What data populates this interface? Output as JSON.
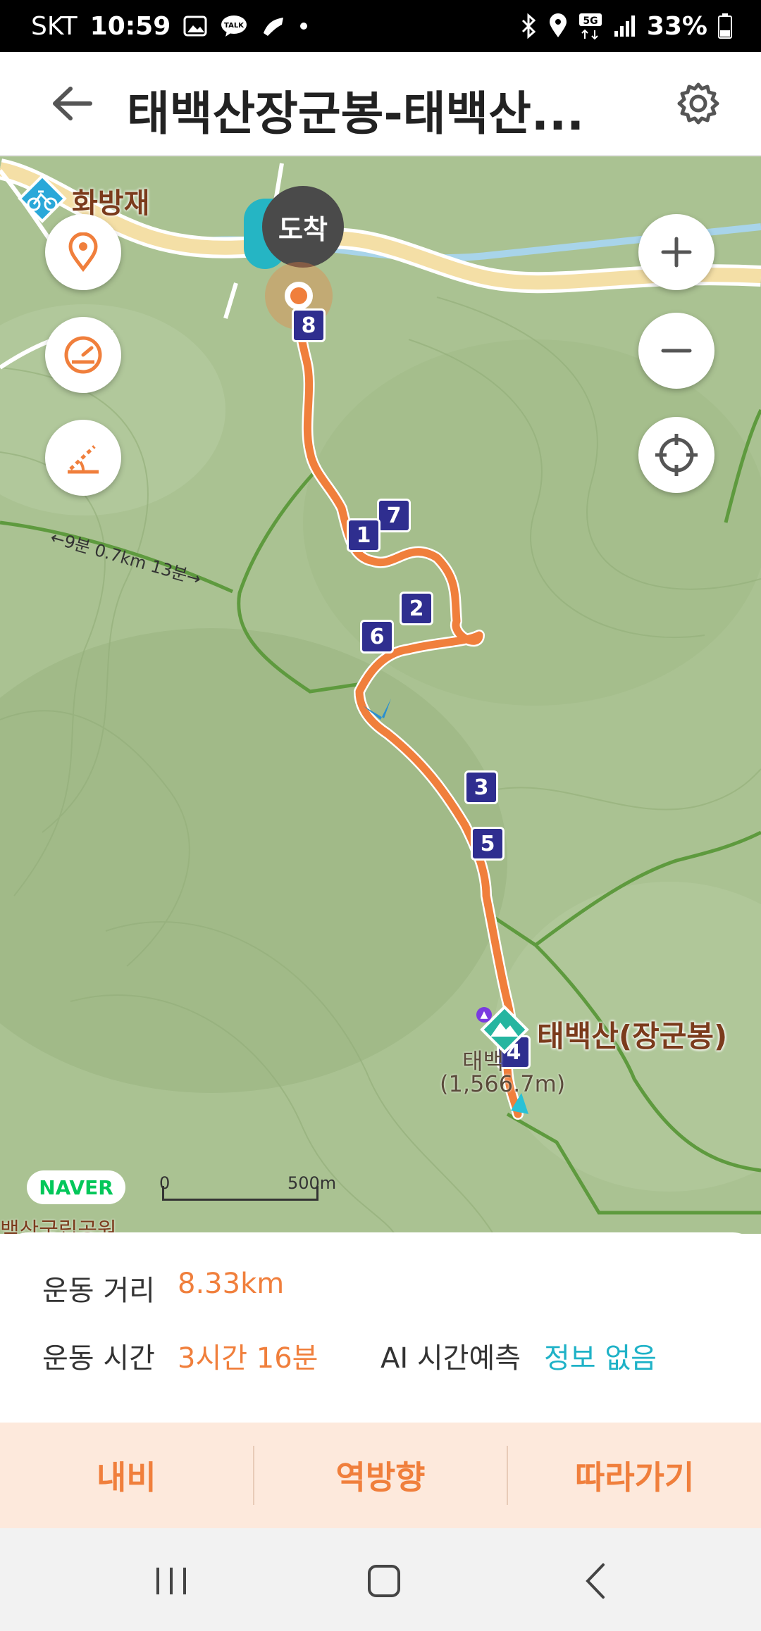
{
  "status_bar": {
    "carrier": "SKT",
    "time": "10:59",
    "battery": "33%"
  },
  "header": {
    "title": "태백산장군봉-태백산..."
  },
  "map": {
    "labels": {
      "hwabangjae": "화방재",
      "arrival": "도착",
      "peak": "태백산(장군봉)",
      "peak_sub1": "태백",
      "peak_sub2": "(1,566.7m)",
      "trail_time": "←9분 0.7km 13분→",
      "park": "백산국립공원"
    },
    "markers": [
      "1",
      "2",
      "3",
      "4",
      "5",
      "6",
      "7",
      "8"
    ],
    "scale": {
      "start": "0",
      "end": "500m"
    },
    "logo": "NAVER",
    "route_color": "#f07f3c"
  },
  "stats": {
    "distance_label": "운동 거리",
    "distance_value": "8.33km",
    "time_label": "운동 시간",
    "time_value": "3시간 16분",
    "ai_label": "AI 시간예측",
    "ai_value": "정보 없음"
  },
  "actions": {
    "navi": "내비",
    "reverse": "역방향",
    "follow": "따라가기"
  },
  "colors": {
    "accent": "#f07f3c",
    "teal": "#1fb2c7",
    "marker": "#2f2e8f"
  }
}
